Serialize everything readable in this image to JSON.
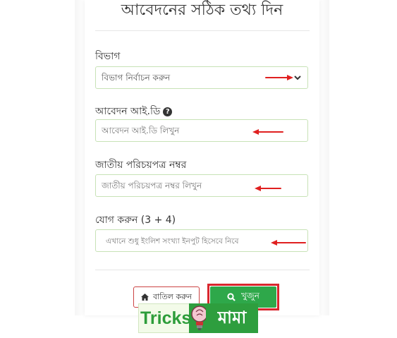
{
  "form": {
    "title": "আবেদনের সঠিক তথ্য দিন",
    "division": {
      "label": "বিভাগ",
      "selected": "বিভাগ নির্বাচন করুন"
    },
    "application_id": {
      "label": "আবেদন আই.ডি",
      "placeholder": "আবেদন আই.ডি লিখুন"
    },
    "nid": {
      "label": "জাতীয় পরিচয়পত্র নম্বর",
      "placeholder": "জাতীয় পরিচয়পত্র নম্বর লিখুন"
    },
    "captcha": {
      "label": "যোগ করুন (3 + 4)",
      "placeholder": "এখানে শুধু ইংলিশ সংখ্যা ইনপুট হিসেবে নিবে"
    },
    "cancel_button": "বাতিল করুন",
    "search_button": "খুজুন"
  },
  "watermark": {
    "left": "Tricks",
    "right": "মামা"
  },
  "icons": {
    "help": "question-circle-icon",
    "chevron": "chevron-down-icon",
    "cancel": "home-icon",
    "search": "search-icon"
  },
  "colors": {
    "primary_green": "#2ea84a",
    "field_border": "#c7e2b6",
    "annotation_red": "#e02020"
  }
}
